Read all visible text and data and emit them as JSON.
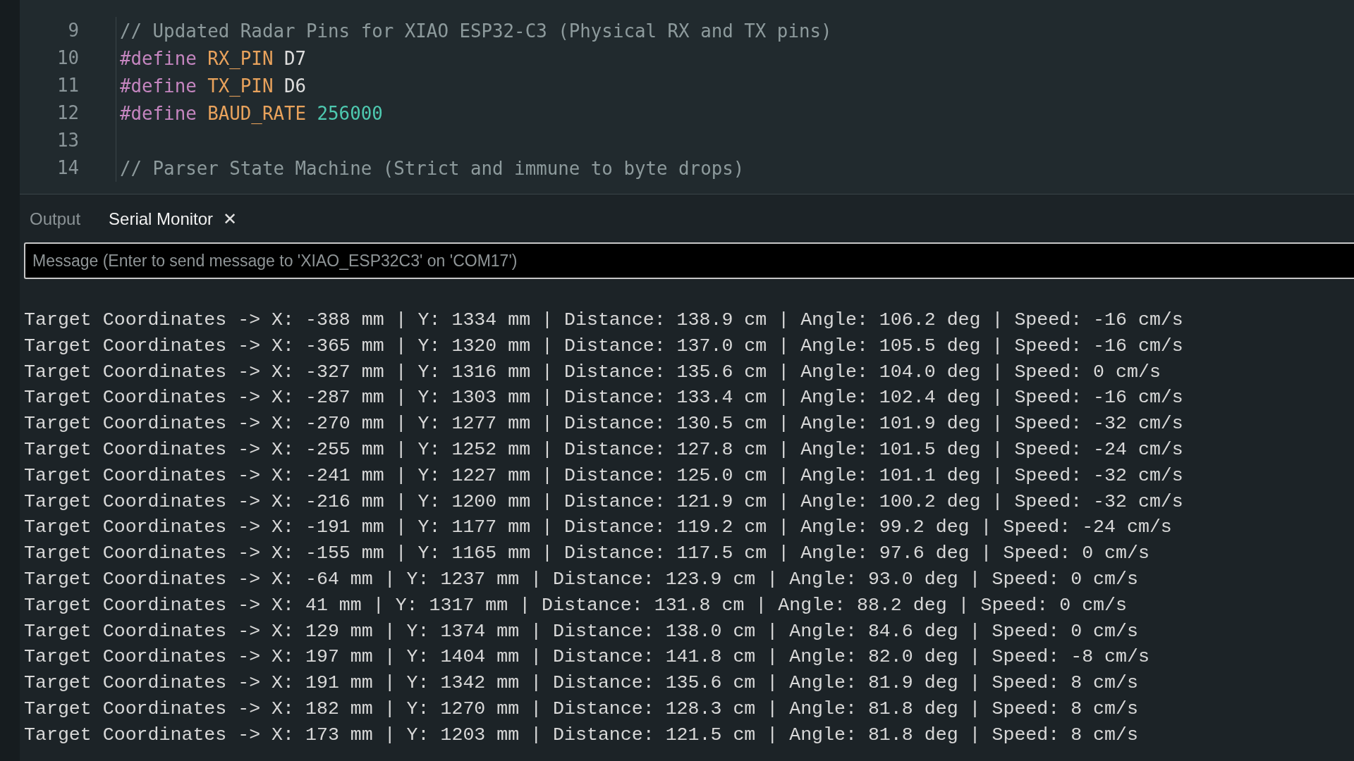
{
  "editor": {
    "lines": [
      {
        "number": "9",
        "tokens": [
          {
            "kind": "comment",
            "text": "// Updated Radar Pins for XIAO ESP32-C3 (Physical RX and TX pins)"
          }
        ]
      },
      {
        "number": "10",
        "tokens": [
          {
            "kind": "directive",
            "text": "#define"
          },
          {
            "kind": "macro",
            "text": "RX_PIN"
          },
          {
            "kind": "plain",
            "text": "D7"
          }
        ]
      },
      {
        "number": "11",
        "tokens": [
          {
            "kind": "directive",
            "text": "#define"
          },
          {
            "kind": "macro",
            "text": "TX_PIN"
          },
          {
            "kind": "plain",
            "text": "D6"
          }
        ]
      },
      {
        "number": "12",
        "tokens": [
          {
            "kind": "directive",
            "text": "#define"
          },
          {
            "kind": "macro",
            "text": "BAUD_RATE"
          },
          {
            "kind": "number",
            "text": "256000"
          }
        ]
      },
      {
        "number": "13"
      },
      {
        "number": "14",
        "tokens": [
          {
            "kind": "comment",
            "text": "// Parser State Machine (Strict and immune to byte drops)"
          }
        ]
      }
    ]
  },
  "panel": {
    "tabs": [
      {
        "label": "Output",
        "selected": false,
        "closable": false
      },
      {
        "label": "Serial Monitor",
        "selected": true,
        "closable": true
      }
    ],
    "close_icon": "✕",
    "message": {
      "placeholder": "Message (Enter to send message to 'XIAO_ESP32C3' on 'COM17')"
    },
    "serial_output": [
      "Target Coordinates -> X: -388 mm | Y: 1334 mm | Distance: 138.9 cm | Angle: 106.2 deg | Speed: -16 cm/s",
      "Target Coordinates -> X: -365 mm | Y: 1320 mm | Distance: 137.0 cm | Angle: 105.5 deg | Speed: -16 cm/s",
      "Target Coordinates -> X: -327 mm | Y: 1316 mm | Distance: 135.6 cm | Angle: 104.0 deg | Speed: 0 cm/s",
      "Target Coordinates -> X: -287 mm | Y: 1303 mm | Distance: 133.4 cm | Angle: 102.4 deg | Speed: -16 cm/s",
      "Target Coordinates -> X: -270 mm | Y: 1277 mm | Distance: 130.5 cm | Angle: 101.9 deg | Speed: -32 cm/s",
      "Target Coordinates -> X: -255 mm | Y: 1252 mm | Distance: 127.8 cm | Angle: 101.5 deg | Speed: -24 cm/s",
      "Target Coordinates -> X: -241 mm | Y: 1227 mm | Distance: 125.0 cm | Angle: 101.1 deg | Speed: -32 cm/s",
      "Target Coordinates -> X: -216 mm | Y: 1200 mm | Distance: 121.9 cm | Angle: 100.2 deg | Speed: -32 cm/s",
      "Target Coordinates -> X: -191 mm | Y: 1177 mm | Distance: 119.2 cm | Angle: 99.2 deg | Speed: -24 cm/s",
      "Target Coordinates -> X: -155 mm | Y: 1165 mm | Distance: 117.5 cm | Angle: 97.6 deg | Speed: 0 cm/s",
      "Target Coordinates -> X: -64 mm | Y: 1237 mm | Distance: 123.9 cm | Angle: 93.0 deg | Speed: 0 cm/s",
      "Target Coordinates -> X: 41 mm | Y: 1317 mm | Distance: 131.8 cm | Angle: 88.2 deg | Speed: 0 cm/s",
      "Target Coordinates -> X: 129 mm | Y: 1374 mm | Distance: 138.0 cm | Angle: 84.6 deg | Speed: 0 cm/s",
      "Target Coordinates -> X: 197 mm | Y: 1404 mm | Distance: 141.8 cm | Angle: 82.0 deg | Speed: -8 cm/s",
      "Target Coordinates -> X: 191 mm | Y: 1342 mm | Distance: 135.6 cm | Angle: 81.9 deg | Speed: 8 cm/s",
      "Target Coordinates -> X: 182 mm | Y: 1270 mm | Distance: 128.3 cm | Angle: 81.8 deg | Speed: 8 cm/s",
      "Target Coordinates -> X: 173 mm | Y: 1203 mm | Distance: 121.5 cm | Angle: 81.8 deg | Speed: 8 cm/s"
    ]
  }
}
